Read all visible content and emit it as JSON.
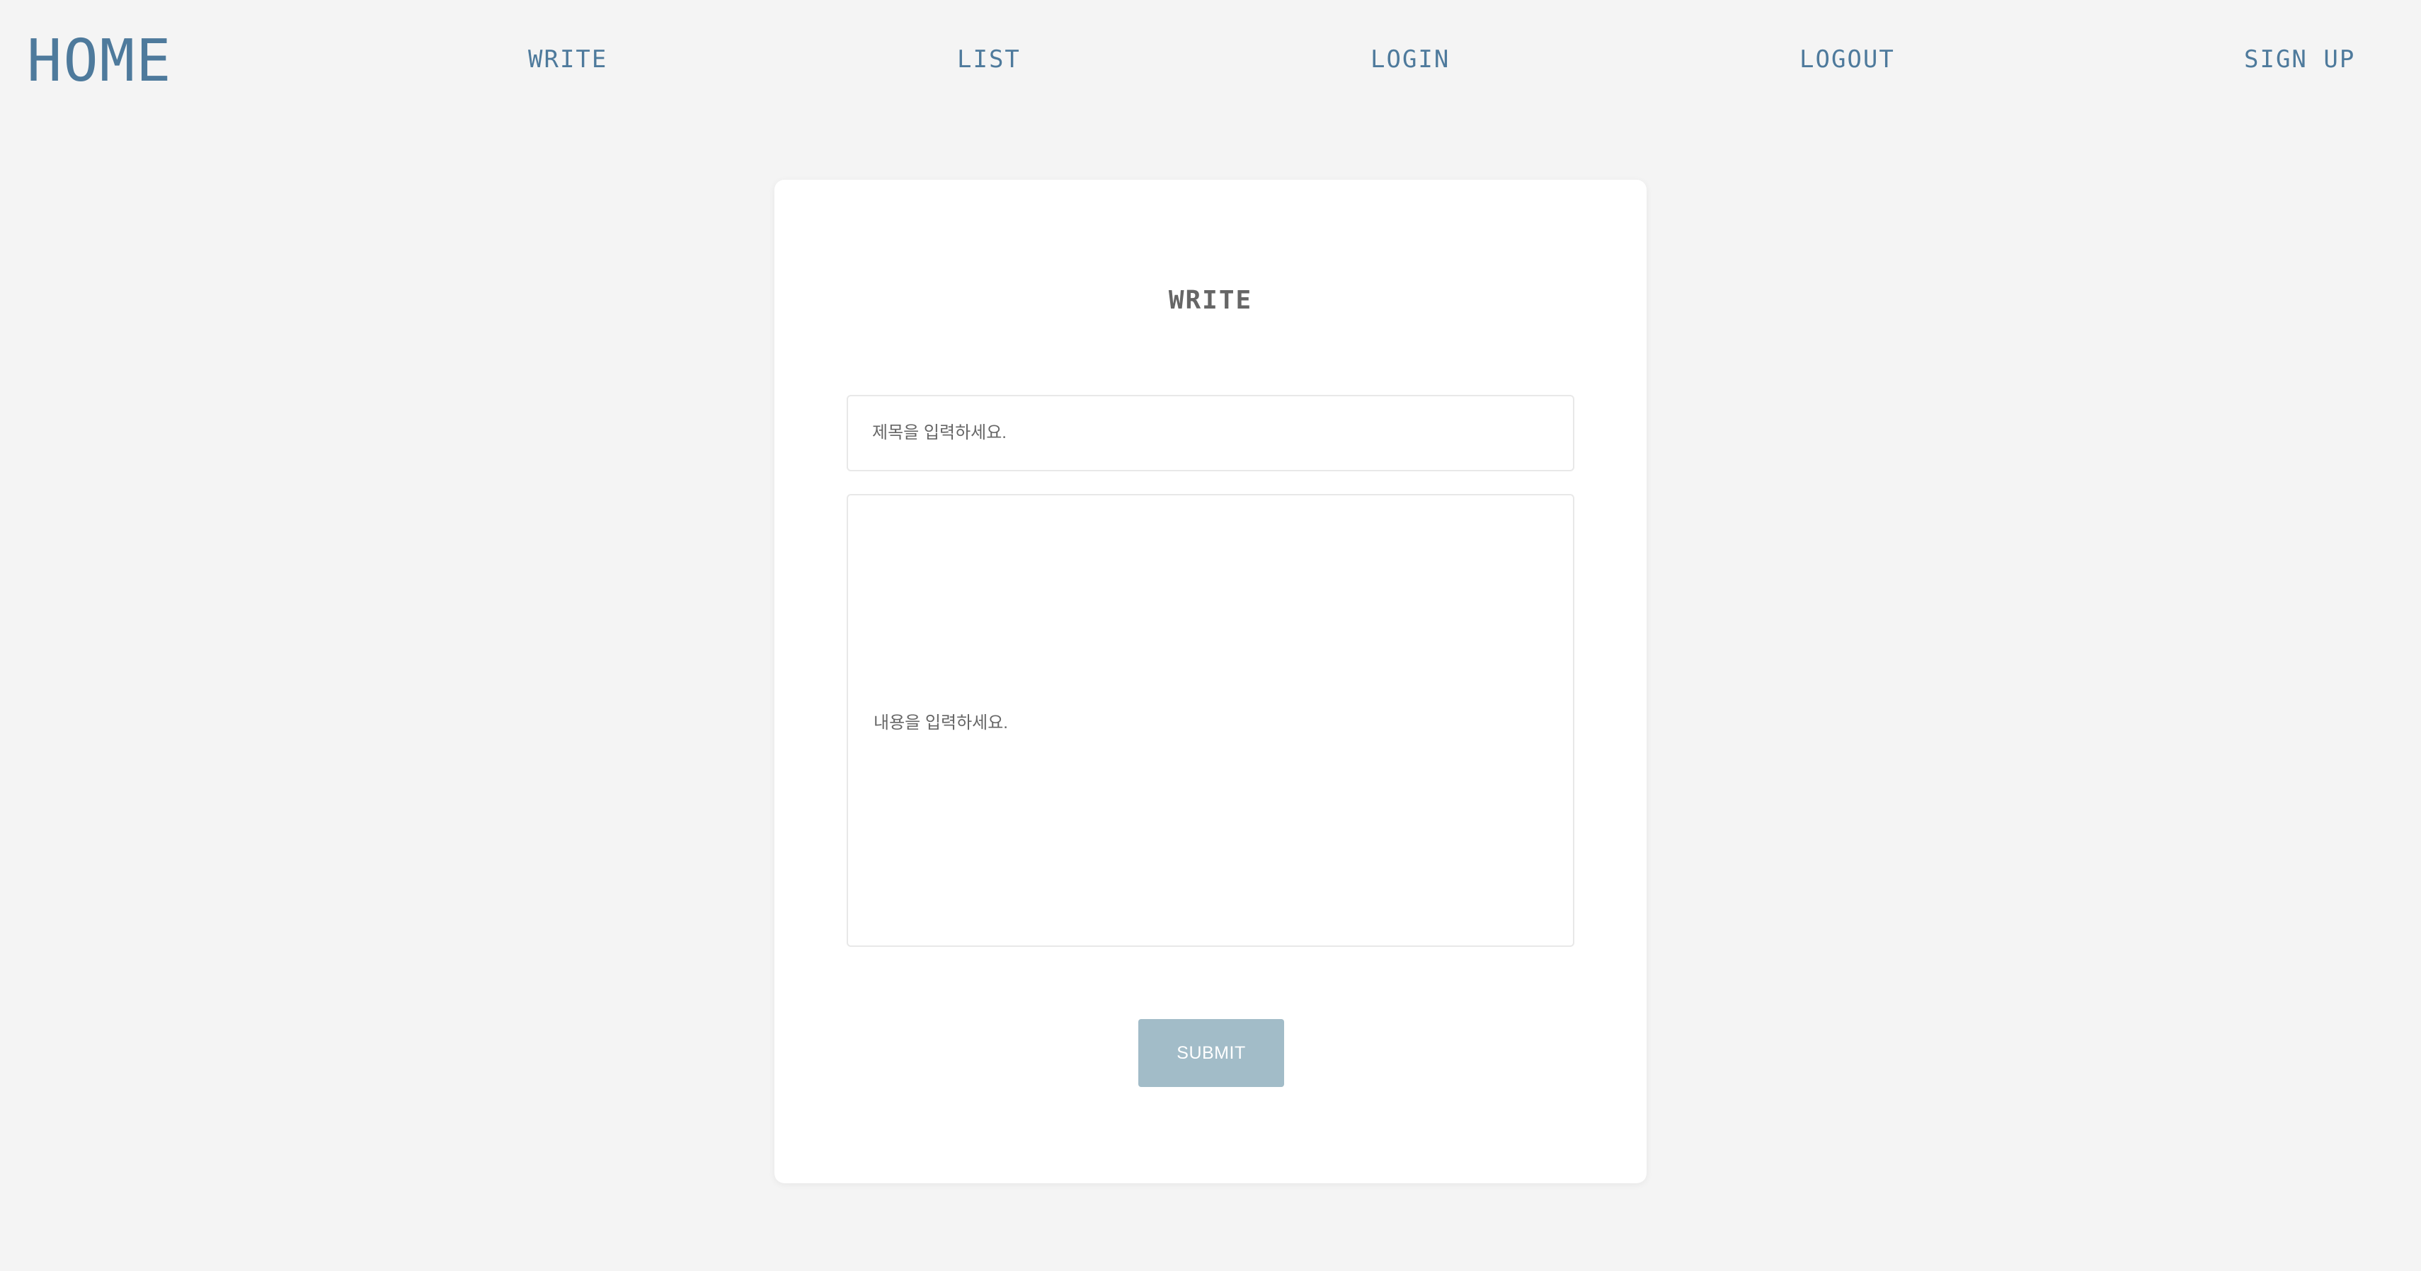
{
  "nav": {
    "home_label": "HOME",
    "items": [
      {
        "label": "WRITE"
      },
      {
        "label": "LIST"
      },
      {
        "label": "LOGIN"
      },
      {
        "label": "LOGOUT"
      },
      {
        "label": "SIGN UP"
      }
    ]
  },
  "form": {
    "title": "WRITE",
    "title_placeholder": "제목을 입력하세요.",
    "title_value": "",
    "content_placeholder": "내용을 입력하세요.",
    "content_value": "",
    "submit_label": "SUBMIT"
  },
  "colors": {
    "background": "#f4f4f4",
    "nav_text": "#4e7a9c",
    "card": "#ffffff",
    "submit_button": "#a2bcc8"
  }
}
